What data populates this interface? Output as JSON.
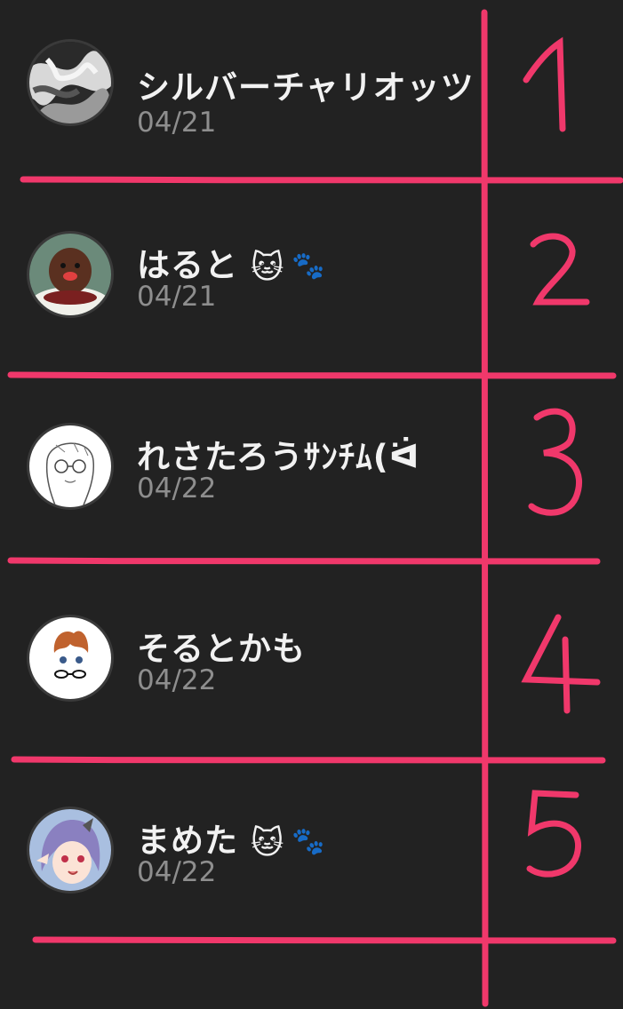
{
  "entries": [
    {
      "name": "シルバーチャリオッツ",
      "date": "04/21"
    },
    {
      "name": "はると",
      "date": "04/21",
      "emoji": "🐱",
      "paw": "🐾"
    },
    {
      "name": "れさたろうｻﾝﾁﾑ(ᐛ",
      "date": "04/22"
    },
    {
      "name": "そるとかも",
      "date": "04/22"
    },
    {
      "name": "まめた",
      "date": "04/22",
      "emoji": "🐱",
      "paw": "🐾"
    }
  ],
  "annotations": {
    "numbers": [
      "1",
      "2",
      "3",
      "4",
      "5"
    ],
    "color": "#f0386b"
  },
  "colors": {
    "background": "#222222",
    "name_text": "#f2f2f2",
    "date_text": "#8e8e8e"
  }
}
